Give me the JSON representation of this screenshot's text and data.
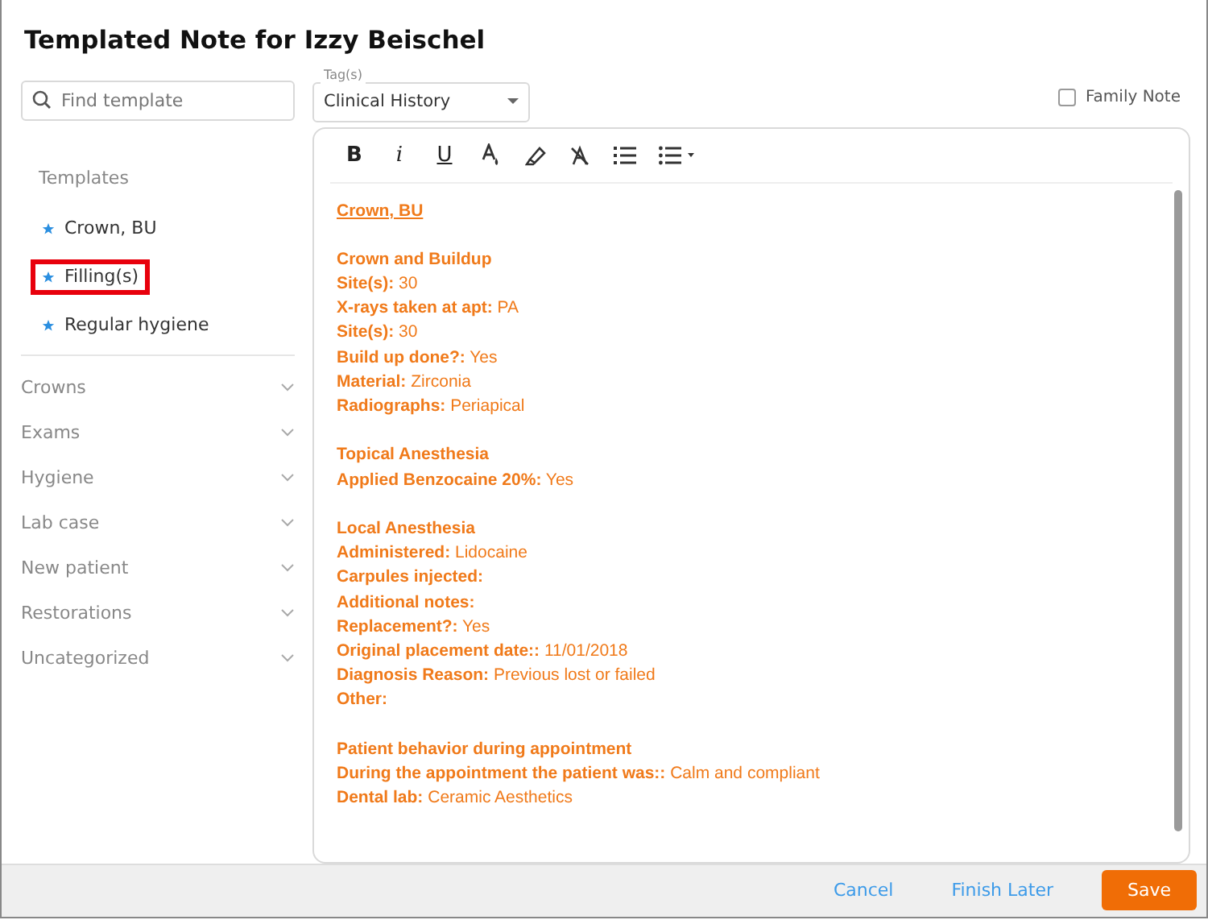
{
  "dialog": {
    "title": "Templated Note for Izzy Beischel"
  },
  "search": {
    "placeholder": "Find template"
  },
  "tags": {
    "label": "Tag(s)",
    "value": "Clinical History"
  },
  "family_note": {
    "label": "Family Note",
    "checked": false
  },
  "templates": {
    "heading": "Templates",
    "items": [
      {
        "label": "Crown, BU",
        "highlighted": false
      },
      {
        "label": "Filling(s)",
        "highlighted": true
      },
      {
        "label": "Regular hygiene",
        "highlighted": false
      }
    ]
  },
  "categories": [
    {
      "label": "Crowns",
      "expanded": false
    },
    {
      "label": "Exams",
      "expanded": false
    },
    {
      "label": "Hygiene",
      "expanded": false
    },
    {
      "label": "Lab case",
      "expanded": false
    },
    {
      "label": "New patient",
      "expanded": false
    },
    {
      "label": "Restorations",
      "expanded": false
    },
    {
      "label": "Uncategorized",
      "expanded": false
    }
  ],
  "toolbar": [
    {
      "kind": "bold",
      "label": "B"
    },
    {
      "kind": "italic",
      "label": "i"
    },
    {
      "kind": "underline",
      "label": "U"
    },
    {
      "kind": "font-color"
    },
    {
      "kind": "highlight"
    },
    {
      "kind": "clear-format"
    },
    {
      "kind": "numbered-list"
    },
    {
      "kind": "bullet-list"
    }
  ],
  "note": [
    {
      "kind": "title",
      "text": "Crown, BU"
    },
    {
      "kind": "blank"
    },
    {
      "kind": "heading",
      "text": "Crown and Buildup"
    },
    {
      "kind": "field",
      "label": "Site(s):",
      "value": "30"
    },
    {
      "kind": "field",
      "label": "X-rays taken at apt:",
      "value": "PA"
    },
    {
      "kind": "field",
      "label": "Site(s):",
      "value": "30"
    },
    {
      "kind": "field",
      "label": "Build up done?:",
      "value": "Yes"
    },
    {
      "kind": "field",
      "label": "Material:",
      "value": "Zirconia"
    },
    {
      "kind": "field",
      "label": "Radiographs:",
      "value": "Periapical"
    },
    {
      "kind": "blank"
    },
    {
      "kind": "heading",
      "text": "Topical Anesthesia"
    },
    {
      "kind": "field",
      "label": "Applied Benzocaine 20%:",
      "value": "Yes"
    },
    {
      "kind": "blank"
    },
    {
      "kind": "heading",
      "text": "Local Anesthesia"
    },
    {
      "kind": "field",
      "label": "Administered:",
      "value": "Lidocaine"
    },
    {
      "kind": "field",
      "label": "Carpules injected:"
    },
    {
      "kind": "field",
      "label": "Additional notes:"
    },
    {
      "kind": "field",
      "label": "Replacement?:",
      "value": "Yes"
    },
    {
      "kind": "field",
      "label": "Original placement date::",
      "value": "11/01/2018"
    },
    {
      "kind": "field",
      "label": "Diagnosis Reason:",
      "value": "Previous lost or failed"
    },
    {
      "kind": "field",
      "label": "Other:"
    },
    {
      "kind": "blank"
    },
    {
      "kind": "heading",
      "text": "Patient behavior during appointment"
    },
    {
      "kind": "field",
      "label": "During the appointment the patient was::",
      "value": "Calm and compliant"
    },
    {
      "kind": "field",
      "label": "Dental lab:",
      "value": "Ceramic Aesthetics"
    }
  ],
  "footer": {
    "buttons": [
      {
        "kind": "link",
        "label": "Cancel"
      },
      {
        "kind": "link",
        "label": "Finish Later"
      },
      {
        "kind": "primary",
        "label": "Save"
      }
    ]
  }
}
